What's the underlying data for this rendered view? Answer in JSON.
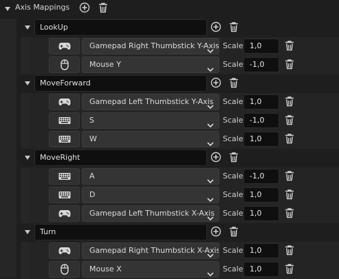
{
  "section": {
    "title": "Axis Mappings"
  },
  "groups": [
    {
      "name": "LookUp",
      "keys": [
        {
          "device": "gamepad-icon",
          "key": "Gamepad Right Thumbstick Y-Axis",
          "scale": "1,0"
        },
        {
          "device": "mouse-icon",
          "key": "Mouse Y",
          "scale": "-1,0"
        }
      ]
    },
    {
      "name": "MoveForward",
      "keys": [
        {
          "device": "gamepad-icon",
          "key": "Gamepad Left Thumbstick Y-Axis",
          "scale": "1,0"
        },
        {
          "device": "keyboard-icon",
          "key": "S",
          "scale": "-1,0"
        },
        {
          "device": "keyboard-icon",
          "key": "W",
          "scale": "1,0"
        }
      ]
    },
    {
      "name": "MoveRight",
      "keys": [
        {
          "device": "keyboard-icon",
          "key": "A",
          "scale": "-1,0"
        },
        {
          "device": "keyboard-icon",
          "key": "D",
          "scale": "1,0"
        },
        {
          "device": "gamepad-icon",
          "key": "Gamepad Left Thumbstick X-Axis",
          "scale": "1,0"
        }
      ]
    },
    {
      "name": "Turn",
      "keys": [
        {
          "device": "gamepad-icon",
          "key": "Gamepad Right Thumbstick X-Axis",
          "scale": "1,0"
        },
        {
          "device": "mouse-icon",
          "key": "Mouse X",
          "scale": "1,0"
        }
      ]
    }
  ],
  "labels": {
    "scale": "Scale"
  },
  "colors": {
    "background": "#1e1e1e",
    "field": "#0f0f0f",
    "combo": "#343434",
    "text": "#d6d6d6"
  }
}
